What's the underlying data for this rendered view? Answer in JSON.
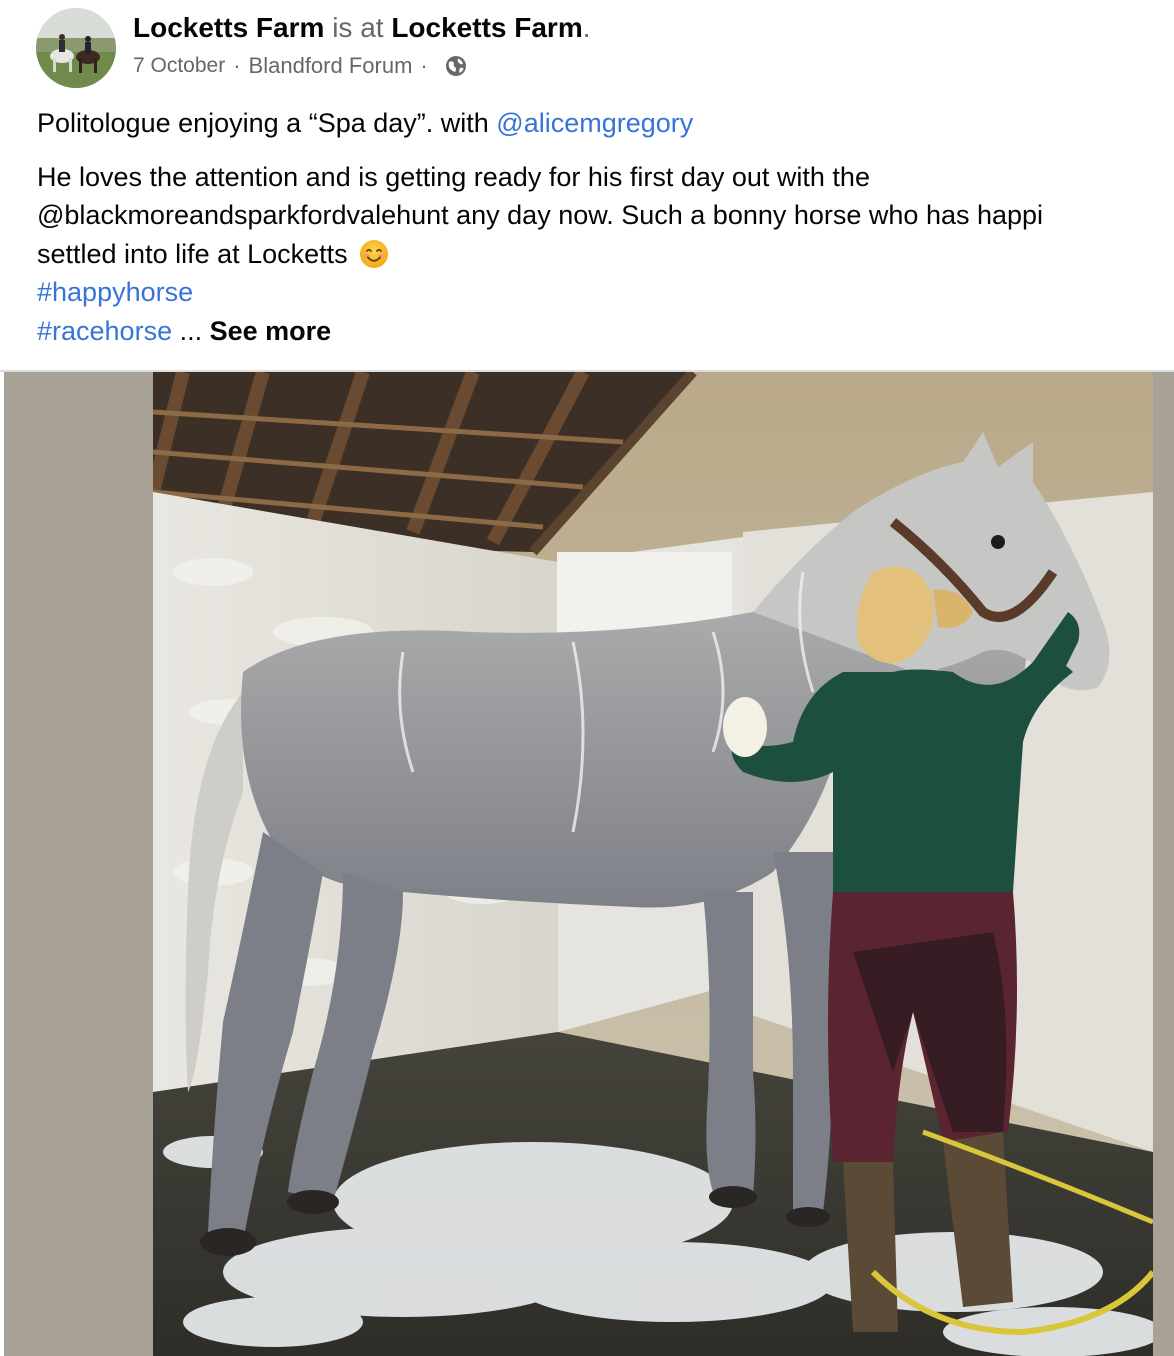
{
  "post": {
    "author": "Locketts Farm",
    "is_at_text": "is at",
    "location_name": "Locketts Farm",
    "period": ".",
    "date": "7 October",
    "separator": "·",
    "place": "Blandford Forum",
    "audience_icon": "globe-icon",
    "avatar_icon": "profile-photo-riders-on-horses"
  },
  "text": {
    "line1_prefix": "Politologue enjoying a “Spa day”. with ",
    "line1_mention": "@alicemgregory",
    "para2_line1": "He loves the attention and is getting ready for his first day out with the",
    "para2_line2": "@blackmoreandsparkfordvalehunt any day now. Such a bonny horse who has happi",
    "para2_line3": "settled into life at Locketts",
    "emoji": "smiling-face-emoji",
    "hashtag1": "#happyhorse",
    "hashtag2": "#racehorse",
    "ellipsis": " ... ",
    "see_more": "See more"
  },
  "media": {
    "photo_icon": "photo-grey-horse-being-washed-in-stable"
  },
  "colors": {
    "link": "#3874d8",
    "secondary_text": "#65676b",
    "media_background": "#a8a195"
  }
}
